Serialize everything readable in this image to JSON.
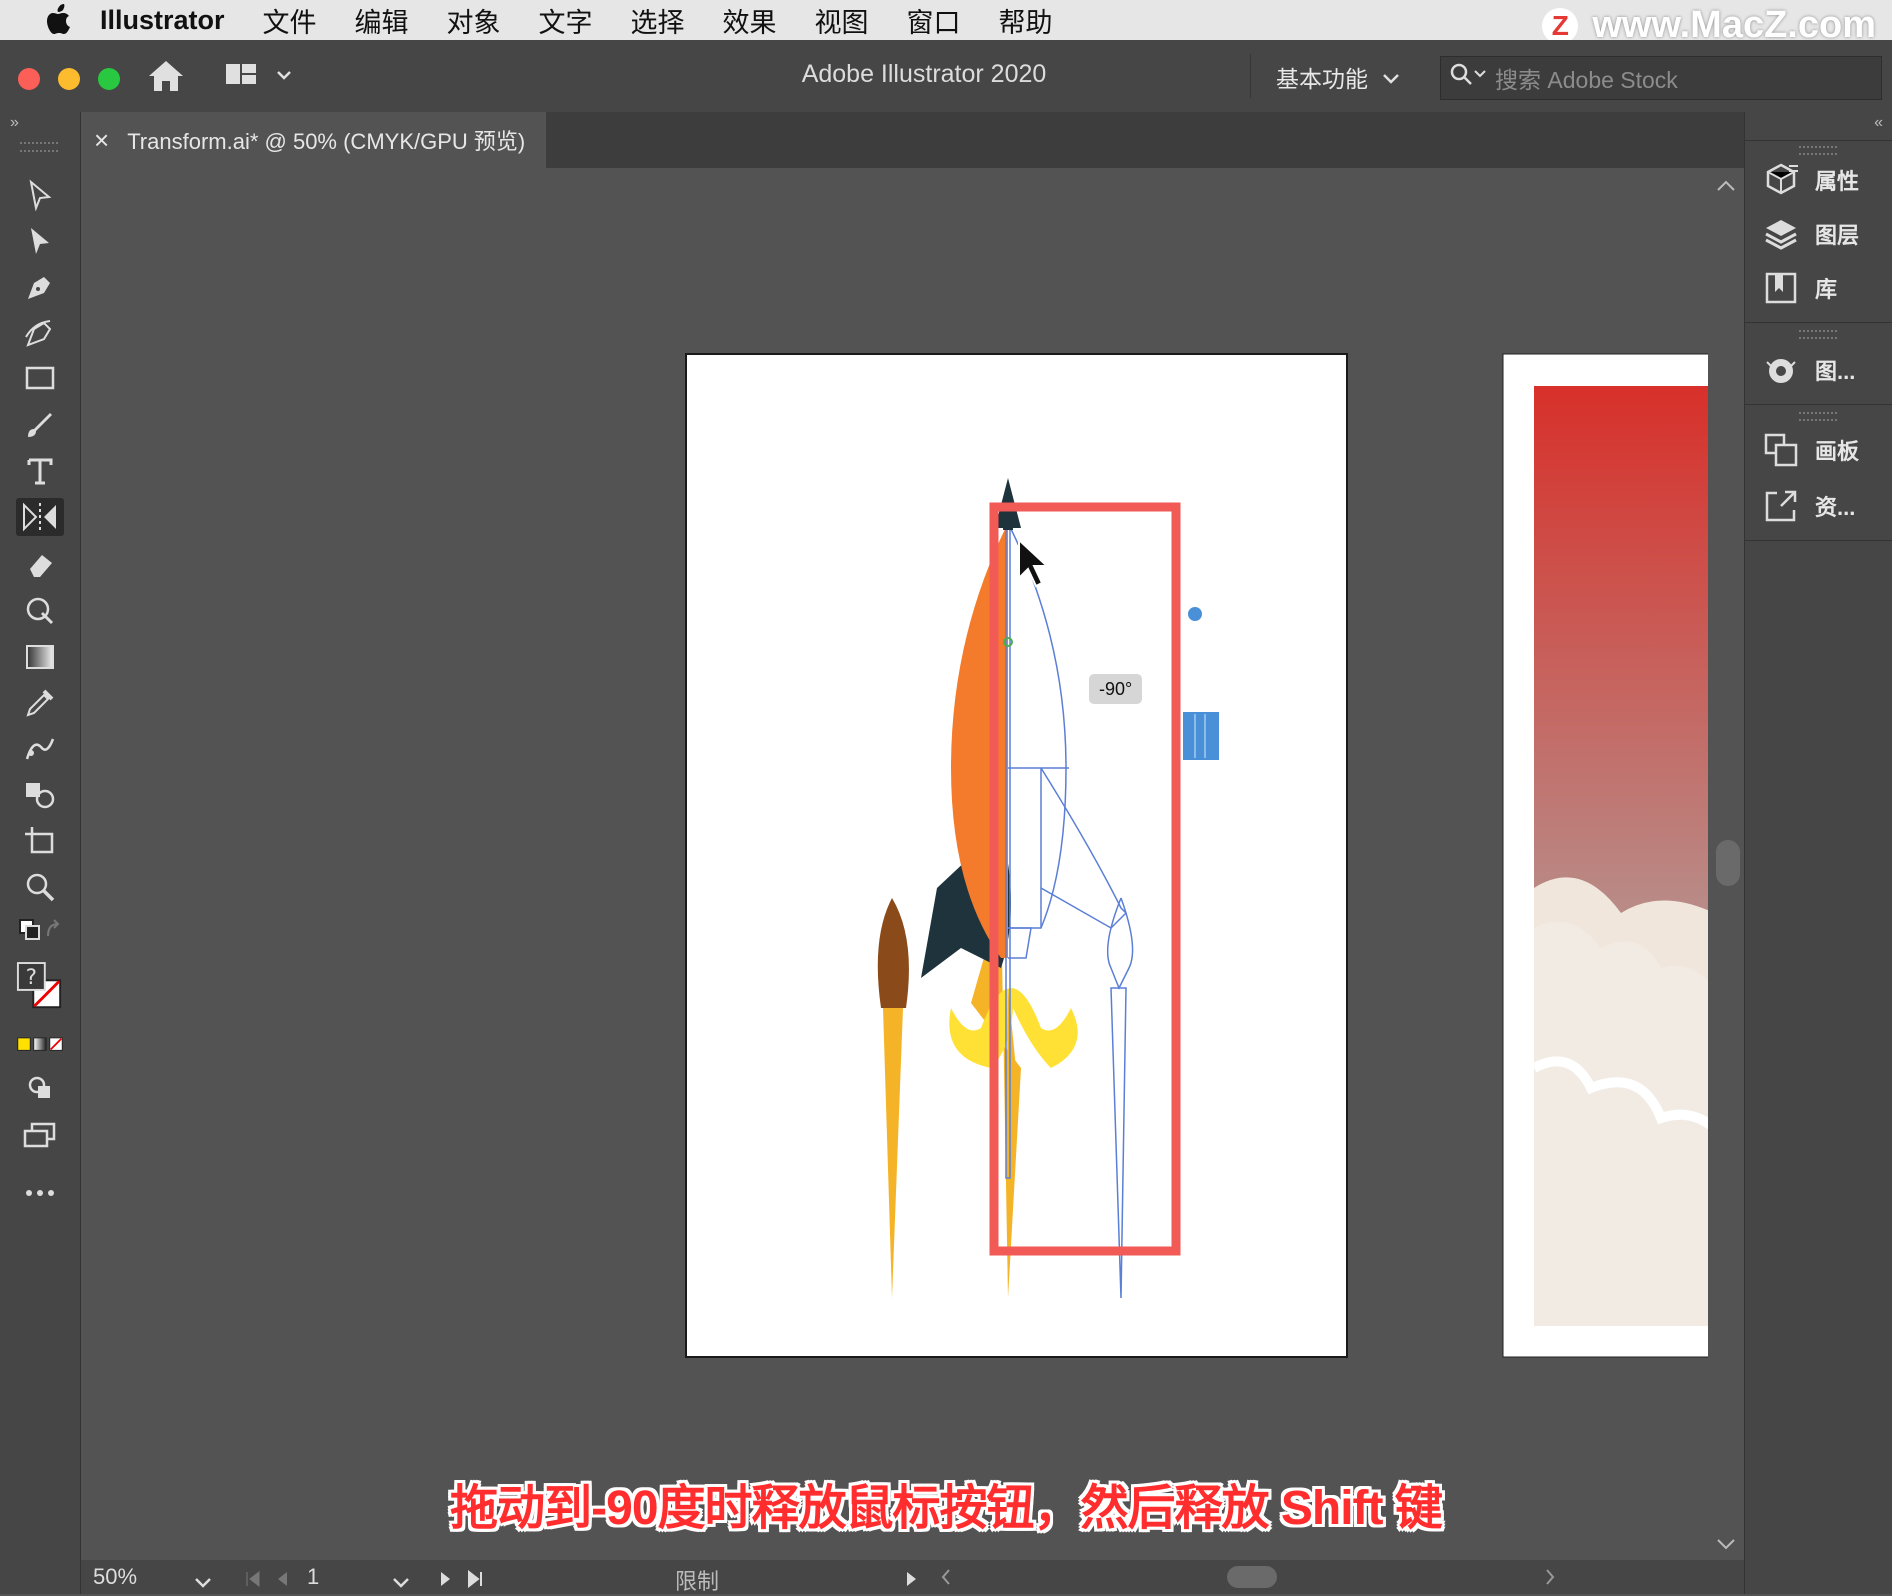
{
  "menubar": {
    "app_name": "Illustrator",
    "items": [
      "文件",
      "编辑",
      "对象",
      "文字",
      "选择",
      "效果",
      "视图",
      "窗口",
      "帮助"
    ],
    "watermark": "www.MacZ.com",
    "watermark_badge": "Z"
  },
  "titlebar": {
    "title": "Adobe Illustrator 2020",
    "workspace_preset": "基本功能",
    "search_placeholder": "搜索 Adobe Stock"
  },
  "document_tab": {
    "close_glyph": "×",
    "label": "Transform.ai* @ 50% (CMYK/GPU 预览)"
  },
  "canvas": {
    "angle_tooltip": "-90°"
  },
  "right_panel": {
    "items": [
      {
        "label": "属性",
        "icon": "properties-icon"
      },
      {
        "label": "图层",
        "icon": "layers-icon"
      },
      {
        "label": "库",
        "icon": "libraries-icon"
      },
      {
        "label": "图...",
        "icon": "color-guide-icon"
      },
      {
        "label": "画板",
        "icon": "artboards-icon"
      },
      {
        "label": "资...",
        "icon": "asset-export-icon"
      }
    ]
  },
  "statusbar": {
    "zoom": "50%",
    "artboard_number": "1",
    "status_text": "限制"
  },
  "caption": "拖动到-90度时释放鼠标按钮，然后释放 Shift 键",
  "colors": {
    "ui_dark": "#464646",
    "canvas_bg": "#535353",
    "selection_highlight": "#f25a55",
    "transform_handle": "#4a90d9",
    "caption": "#ff2d2d"
  }
}
